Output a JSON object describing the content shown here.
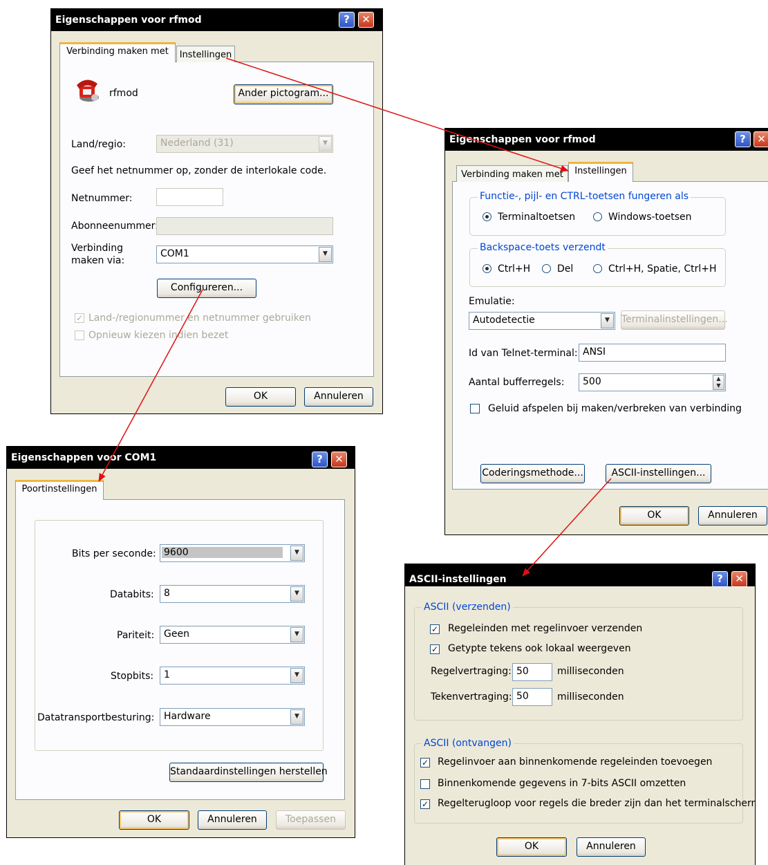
{
  "rfmod": {
    "title": "Eigenschappen voor rfmod",
    "tab_connect": "Verbinding maken met",
    "tab_settings": "Instellingen",
    "name": "rfmod",
    "change_icon": "Ander pictogram...",
    "country_label": "Land/regio:",
    "country_value": "Nederland (31)",
    "hint": "Geef het netnummer op, zonder de interlokale code.",
    "area_label": "Netnummer:",
    "area_value": "",
    "subscriber_label": "Abonneenummer:",
    "subscriber_value": "",
    "connect_via_label_1": "Verbinding",
    "connect_via_label_2": "maken via:",
    "connect_via_value": "COM1",
    "configure": "Configureren...",
    "use_codes": "Land-/regionummer en netnummer gebruiken",
    "redial": "Opnieuw kiezen indien bezet",
    "ok": "OK",
    "cancel": "Annuleren"
  },
  "settings": {
    "title": "Eigenschappen voor rfmod",
    "tab_connect": "Verbinding maken met",
    "tab_settings": "Instellingen",
    "keys_group": "Functie-, pijl- en CTRL-toetsen fungeren als",
    "terminal_keys": "Terminaltoetsen",
    "windows_keys": "Windows-toetsen",
    "backspace_group": "Backspace-toets verzendt",
    "ctrl_h": "Ctrl+H",
    "del": "Del",
    "ctrl_h_space": "Ctrl+H, Spatie, Ctrl+H",
    "emulation_label": "Emulatie:",
    "emulation_value": "Autodetectie",
    "terminal_settings": "Terminalinstellingen...",
    "telnet_label": "Id van Telnet-terminal:",
    "telnet_value": "ANSI",
    "buffer_label": "Aantal bufferregels:",
    "buffer_value": "500",
    "sound_label": "Geluid afspelen bij maken/verbreken van verbinding",
    "encoding": "Coderingsmethode...",
    "ascii_settings": "ASCII-instellingen...",
    "ok": "OK",
    "cancel": "Annuleren"
  },
  "com1": {
    "title": "Eigenschappen voor COM1",
    "tab_port": "Poortinstellingen",
    "bps_label": "Bits per seconde:",
    "bps_value": "9600",
    "databits_label": "Databits:",
    "databits_value": "8",
    "parity_label": "Pariteit:",
    "parity_value": "Geen",
    "stopbits_label": "Stopbits:",
    "stopbits_value": "1",
    "flow_label": "Datatransportbesturing:",
    "flow_value": "Hardware",
    "restore": "Standaardinstellingen herstellen",
    "ok": "OK",
    "cancel": "Annuleren",
    "apply": "Toepassen"
  },
  "ascii": {
    "title": "ASCII-instellingen",
    "send_group": "ASCII (verzenden)",
    "send_line_ends": "Regeleinden met regelinvoer verzenden",
    "echo_local": "Getypte tekens ook lokaal weergeven",
    "line_delay_label": "Regelvertraging:",
    "line_delay_value": "50",
    "char_delay_label": "Tekenvertraging:",
    "char_delay_value": "50",
    "ms": "milliseconden",
    "receive_group": "ASCII (ontvangen)",
    "append_linefeed": "Regelinvoer aan binnenkomende regeleinden toevoegen",
    "force_7bit": "Binnenkomende gegevens in 7-bits ASCII omzetten",
    "wrap_lines": "Regelterugloop voor regels die breder zijn dan het terminalscherm",
    "ok": "OK",
    "cancel": "Annuleren"
  },
  "annotation_color": "#e01010"
}
